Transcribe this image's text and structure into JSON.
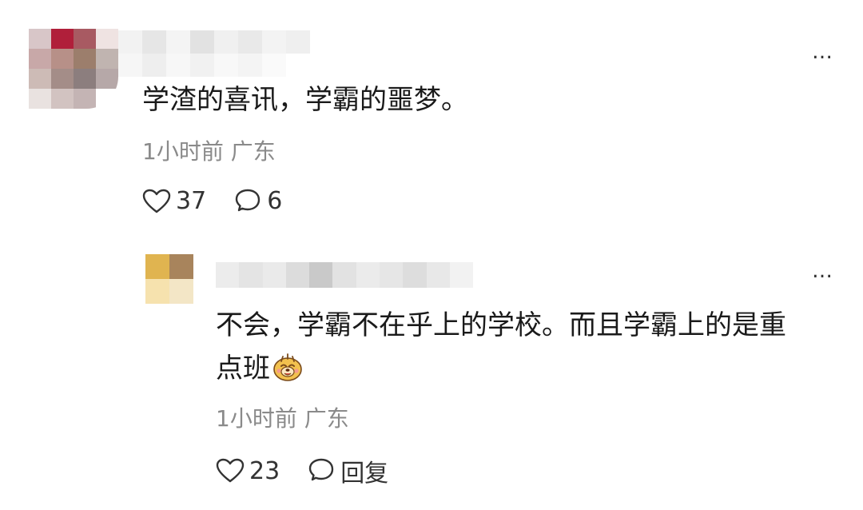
{
  "colors": {
    "text": "#1a1a1a",
    "meta": "#8a8a8a",
    "icon": "#333333"
  },
  "comment": {
    "text": "学渣的喜讯，学霸的噩梦。",
    "time": "1小时前",
    "location": "广东",
    "likes": "37",
    "replies": "6",
    "more_icon": "…"
  },
  "reply": {
    "text_line1": "不会，学霸不在乎上的学校。而且学霸上的是重",
    "text_line2": "点班",
    "time": "1小时前",
    "location": "广东",
    "likes": "23",
    "reply_label": "回复",
    "more_icon": "…"
  },
  "icons": {
    "like": "heart-outline-icon",
    "comment": "speech-bubble-icon",
    "emoji": "smiling-dog-emoji-icon"
  }
}
